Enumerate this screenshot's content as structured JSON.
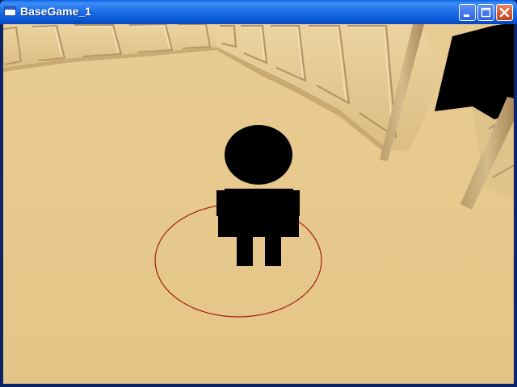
{
  "window": {
    "title": "BaseGame_1",
    "icon": "application-window-icon",
    "controls": [
      "minimize",
      "maximize",
      "close"
    ]
  },
  "scene": {
    "floor_color": "#e6c68a",
    "wall_color": "#e9cd98",
    "player_color": "#000000",
    "selection_ring_color": "#a31c0e"
  }
}
